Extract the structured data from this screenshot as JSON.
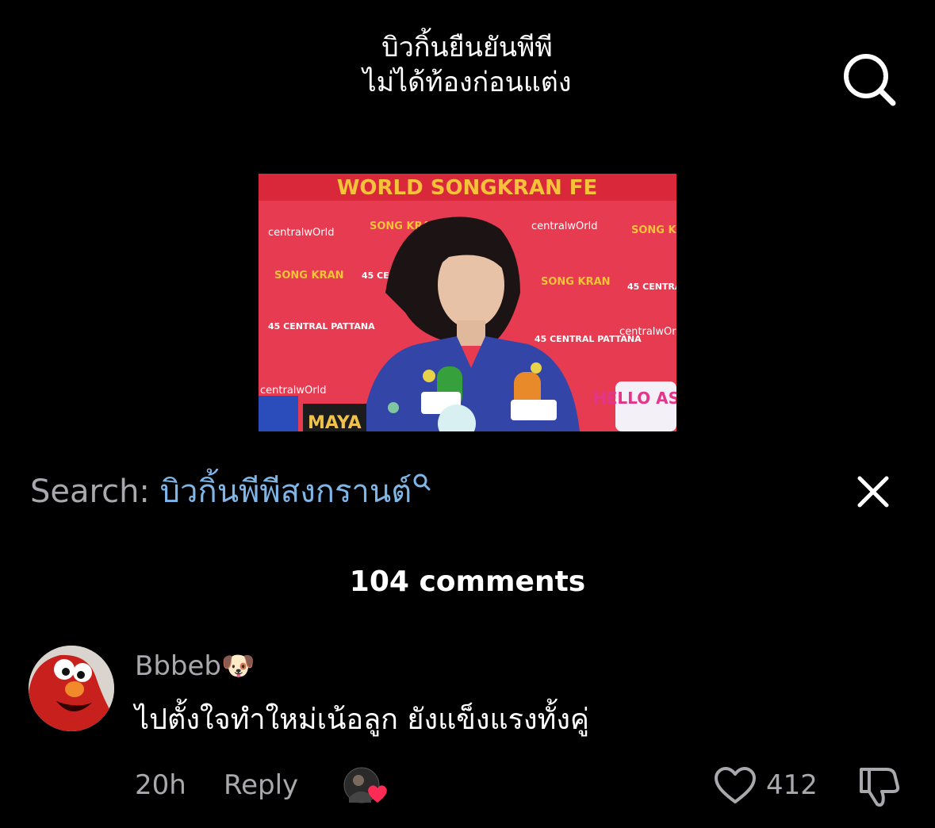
{
  "header": {
    "title_line1": "บิวกิ้นยืนยันพีพี",
    "title_line2": "ไม่ได้ท้องก่อนแต่ง"
  },
  "video": {
    "banner_text": "WORLD SONGKRAN FE",
    "backdrop_texts": [
      "centralwOrld",
      "SONG KRAN",
      "45 CENTRAL PATTANA"
    ],
    "badge_text": "HELLO ASIA",
    "mic_label": "MAYA"
  },
  "search": {
    "prefix": "Search:",
    "term": "บิวกิ้นพีพีสงกรานต์"
  },
  "comments": {
    "count_label": "104 comments",
    "items": [
      {
        "username": "Bbbeb",
        "username_emoji": "🐶",
        "text": "ไปตั้งใจทำใหม่เน้อลูก ยังแข็งแรงทั้งคู่",
        "time": "20h",
        "reply_label": "Reply",
        "likes": "412"
      }
    ]
  },
  "icons": {
    "search": "search-icon",
    "close": "close-icon",
    "like": "heart-icon",
    "dislike": "thumbs-down-icon"
  },
  "colors": {
    "background": "#000000",
    "search_term": "#7fb6e8",
    "muted_text": "#a8a8ad",
    "liker_heart": "#fe2c55"
  }
}
